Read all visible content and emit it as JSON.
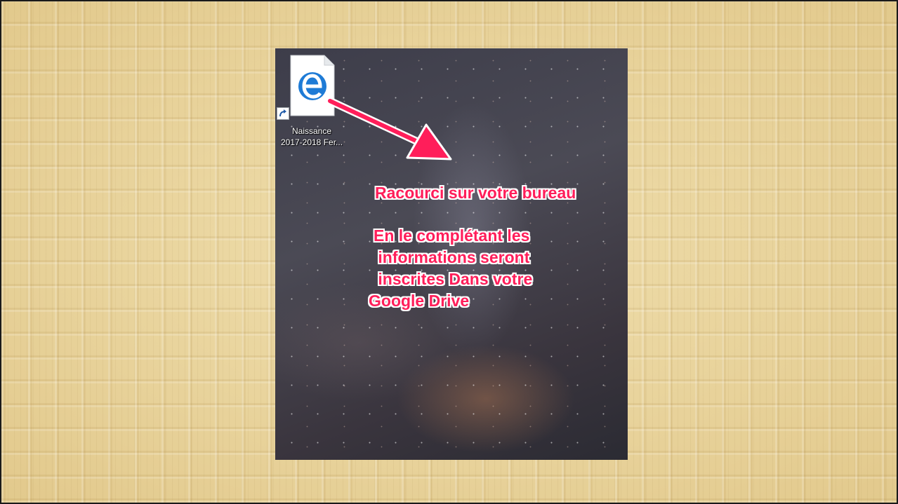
{
  "desktop_icon": {
    "icon": "edge-file-shortcut-icon",
    "label_line1": "Naissance",
    "label_line2": "2017-2018 Fer..."
  },
  "annotation": {
    "title": "Racourci sur votre bureau",
    "body_lines": [
      "En le complétant les",
      " informations seront",
      " inscrites Dans votre",
      "Google Drive"
    ],
    "color": "#ff1e5a"
  },
  "colors": {
    "slide_background": "#e8d4a0",
    "edge_blue": "#1e7bd6"
  }
}
